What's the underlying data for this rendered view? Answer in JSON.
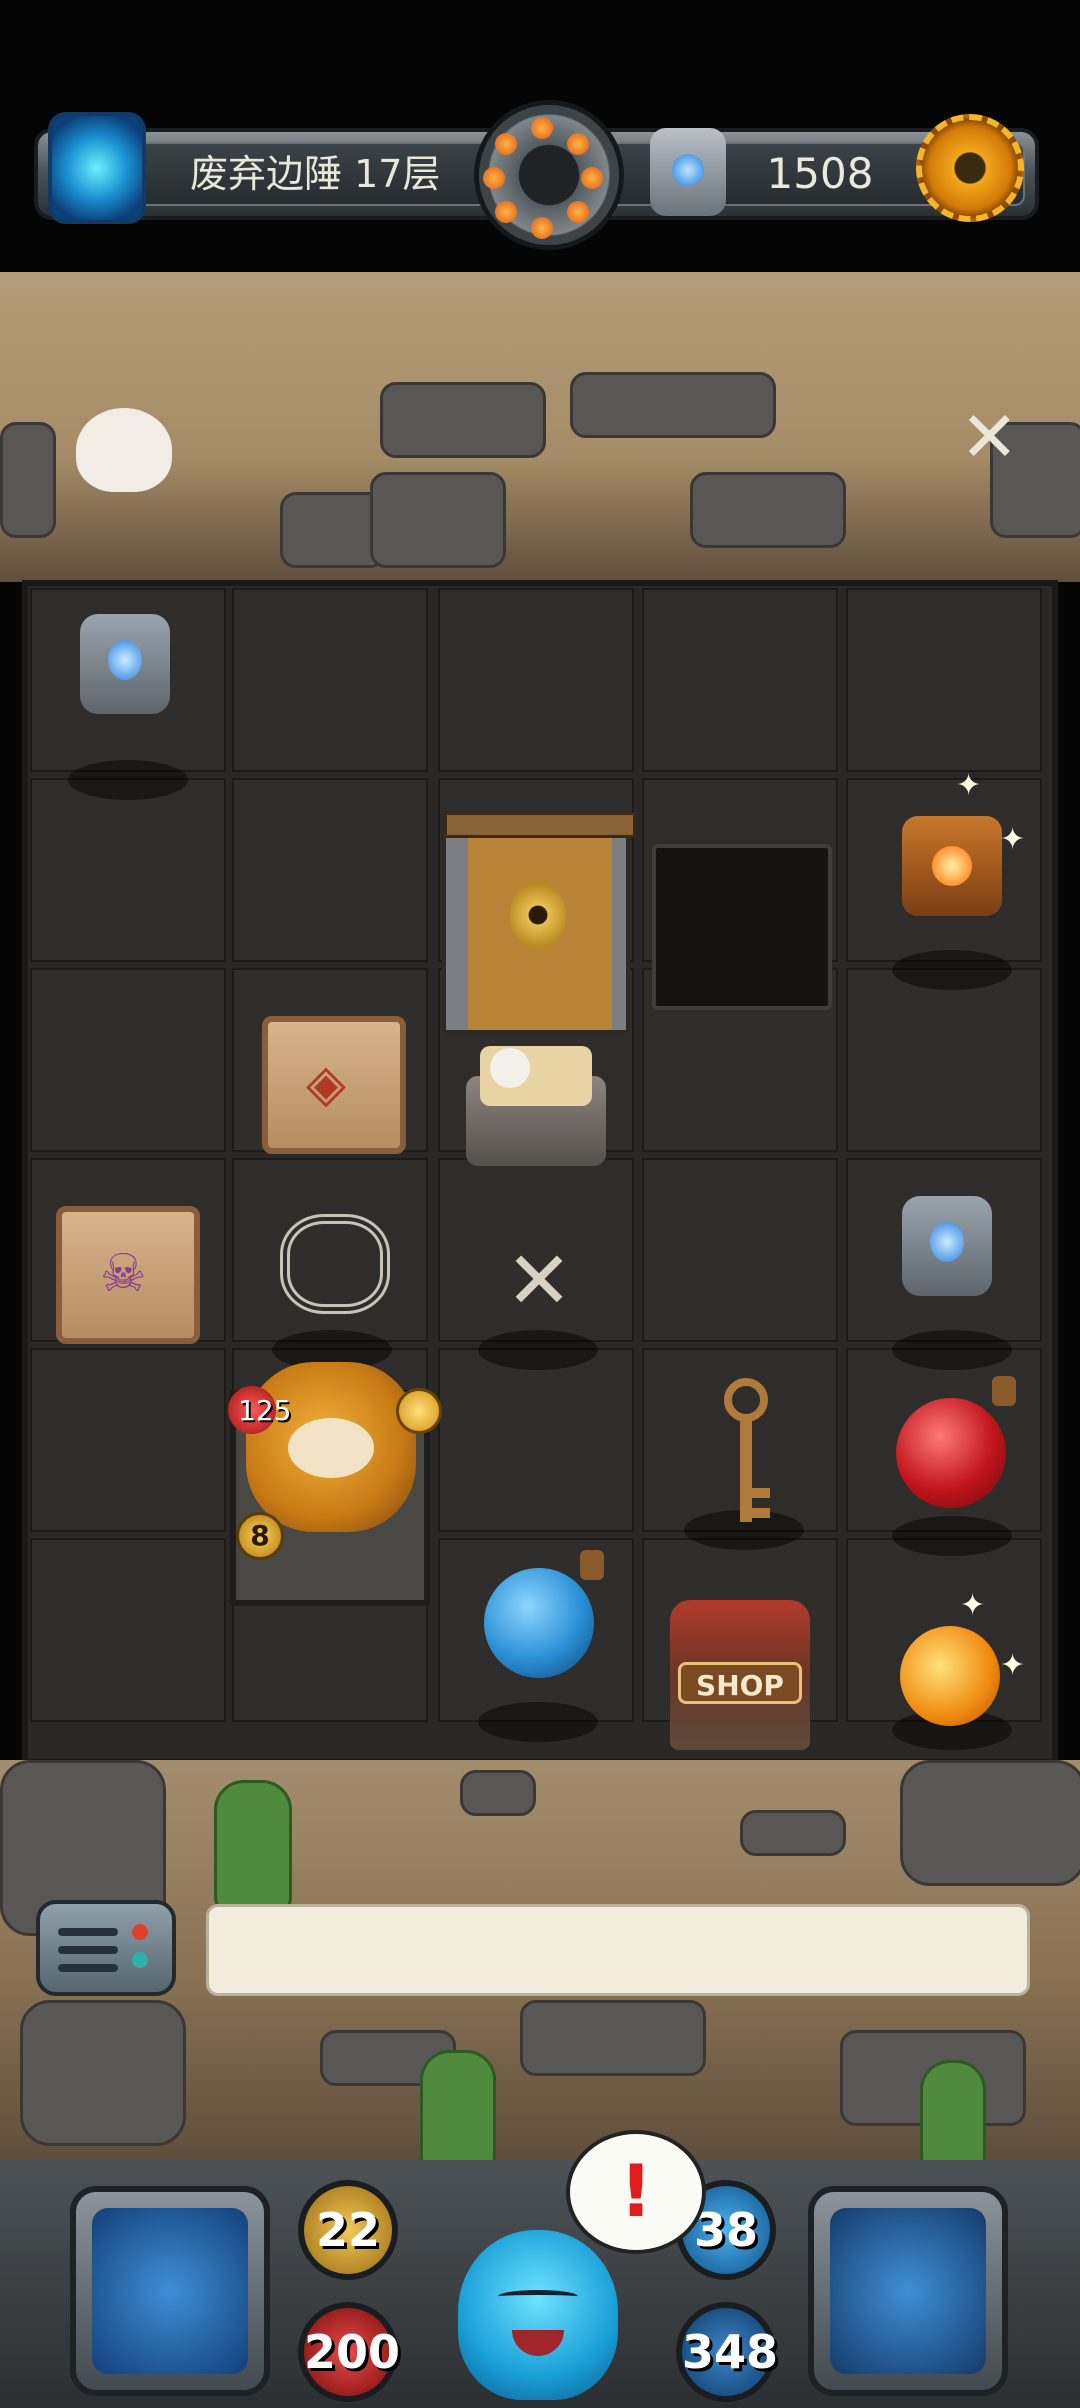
{
  "header": {
    "floor_title": "废弃边陲 17层",
    "currency_amount": "1508"
  },
  "board": {
    "hero": {
      "hp": "125",
      "attack": "8"
    },
    "shop_label": "SHOP"
  },
  "message_box": {
    "text": ""
  },
  "footer_stats": {
    "attack": "22",
    "hp": "200",
    "defense": "38",
    "gold": "348"
  },
  "alert": {
    "symbol": "!"
  },
  "colors": {
    "attack_orb": "#c69a2a",
    "hp_orb": "#b81f1f",
    "defense_orb": "#1f8fd6",
    "gold_orb": "#2a6fb0",
    "alert": "#e21c1c"
  }
}
